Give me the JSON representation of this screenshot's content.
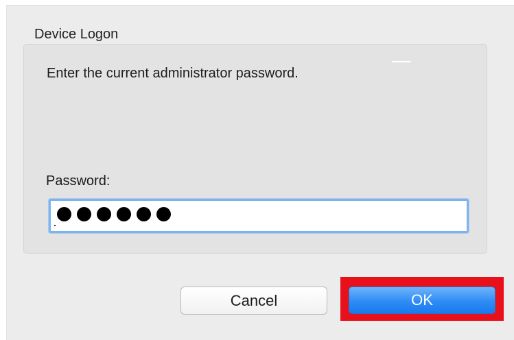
{
  "dialog": {
    "group_title": "Device Logon",
    "message": "Enter the current administrator password.",
    "password": {
      "label": "Password:",
      "masked_length": 6
    },
    "buttons": {
      "cancel_label": "Cancel",
      "ok_label": "OK"
    }
  },
  "colors": {
    "ok_button": "#2f8cf5",
    "focus_ring": "#7fb3ea",
    "highlight_box": "#e8101a"
  }
}
